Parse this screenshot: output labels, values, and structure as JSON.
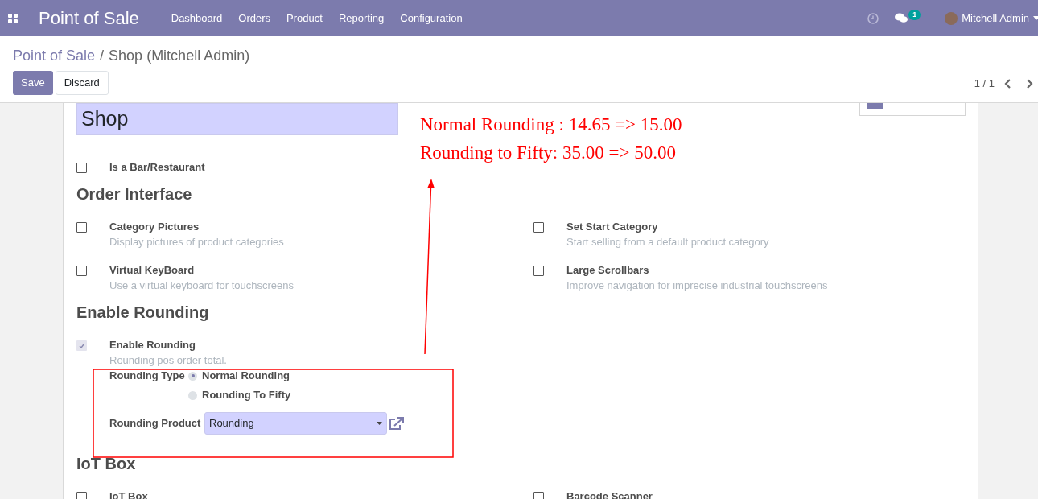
{
  "navbar": {
    "app_name": "Point of Sale",
    "menu": [
      "Dashboard",
      "Orders",
      "Product",
      "Reporting",
      "Configuration"
    ],
    "messages_count": "1",
    "user": "Mitchell Admin"
  },
  "breadcrumb": {
    "parent": "Point of Sale",
    "separator": "/",
    "current": "Shop (Mitchell Admin)"
  },
  "buttons": {
    "save": "Save",
    "discard": "Discard"
  },
  "pager": "1 / 1",
  "form": {
    "name": "Shop",
    "top_setting": {
      "label": "Is a Bar/Restaurant",
      "checked": false
    },
    "sections": [
      {
        "title": "Order Interface",
        "settings": [
          {
            "label": "Category Pictures",
            "description": "Display pictures of product categories",
            "checked": false
          },
          {
            "label": "Set Start Category",
            "description": "Start selling from a default product category",
            "checked": false
          },
          {
            "label": "Virtual KeyBoard",
            "description": "Use a virtual keyboard for touchscreens",
            "checked": false
          },
          {
            "label": "Large Scrollbars",
            "description": "Improve navigation for imprecise industrial touchscreens",
            "checked": false
          }
        ]
      },
      {
        "title": "Enable Rounding",
        "settings": [
          {
            "label": "Enable Rounding",
            "description": "Rounding pos order total.",
            "checked": true,
            "readonly": true,
            "rounding_type_label": "Rounding Type",
            "rounding_options": [
              {
                "label": "Normal Rounding",
                "selected": true
              },
              {
                "label": "Rounding To Fifty",
                "selected": false
              }
            ],
            "product_label": "Rounding Product",
            "product_value": "Rounding"
          }
        ]
      },
      {
        "title": "IoT Box",
        "settings": [
          {
            "label": "IoT Box",
            "checked": false
          },
          {
            "label": "Barcode Scanner",
            "checked": false
          }
        ]
      }
    ]
  },
  "annotation": {
    "lines": [
      "Normal Rounding : 14.65 => 15.00",
      "Rounding to Fifty: 35.00 => 50.00"
    ]
  }
}
